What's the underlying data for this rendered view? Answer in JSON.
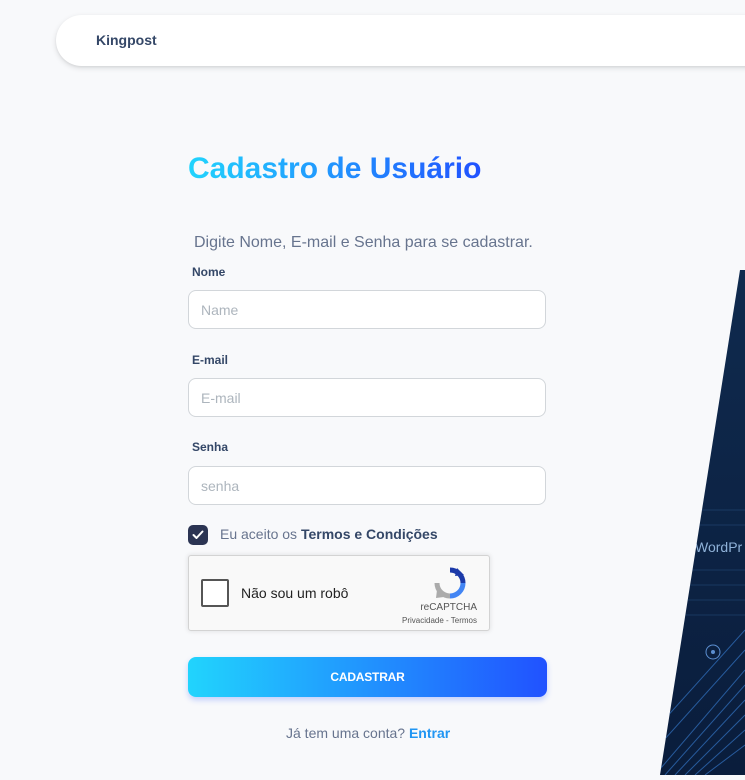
{
  "navbar": {
    "brand": "Kingpost"
  },
  "form": {
    "title": "Cadastro de Usuário",
    "subtitle": "Digite Nome, E-mail e Senha para se cadastrar.",
    "name_label": "Nome",
    "name_placeholder": "Name",
    "email_label": "E-mail",
    "email_placeholder": "E-mail",
    "password_label": "Senha",
    "password_placeholder": "senha",
    "terms_prefix": "Eu aceito os",
    "terms_link": "Termos e Condições",
    "terms_checked": true,
    "submit_label": "CADASTRAR"
  },
  "captcha": {
    "label": "Não sou um robô",
    "brand": "reCAPTCHA",
    "privacy": "Privacidade",
    "separator": " - ",
    "terms": "Termos"
  },
  "footer": {
    "prompt": "Já tem uma conta?",
    "signin_label": "Entrar"
  },
  "decor": {
    "partial_text": "WordPr"
  },
  "colors": {
    "accent_start": "#21d4fd",
    "accent_end": "#2152ff",
    "link": "#2196f3",
    "text_dark": "#344767",
    "panel_dark": "#0d2447"
  }
}
